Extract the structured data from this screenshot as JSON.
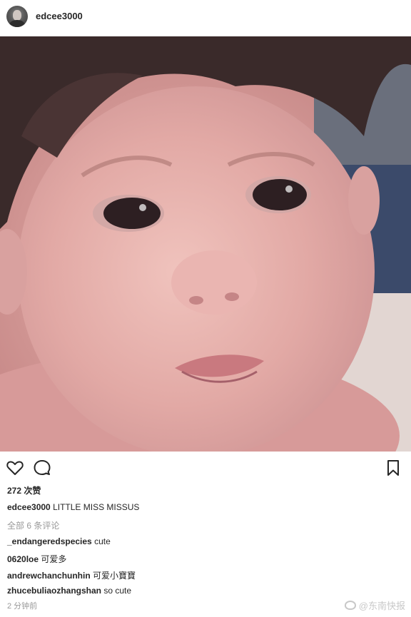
{
  "post": {
    "username": "edcee3000",
    "likes_text": "272 次赞",
    "caption_user": "edcee3000",
    "caption_text": "LITTLE MISS MISSUS",
    "all_comments_text": "全部 6 条评论",
    "comments": [
      {
        "user": "_endangeredspecies",
        "text": "cute"
      },
      {
        "user": "0620loe",
        "text": "可爱多"
      },
      {
        "user": "andrewchanchunhin",
        "text": "可爱小寶寶"
      },
      {
        "user": "zhucebuliaozhangshan",
        "text": "so cute"
      }
    ],
    "time_text": "2 分钟前"
  },
  "watermark": {
    "text": "@东南快报"
  },
  "icons": {
    "avatar": "avatar",
    "like": "heart-icon",
    "comment": "comment-bubble-icon",
    "save": "bookmark-icon",
    "watermark_logo": "weibo-icon"
  }
}
